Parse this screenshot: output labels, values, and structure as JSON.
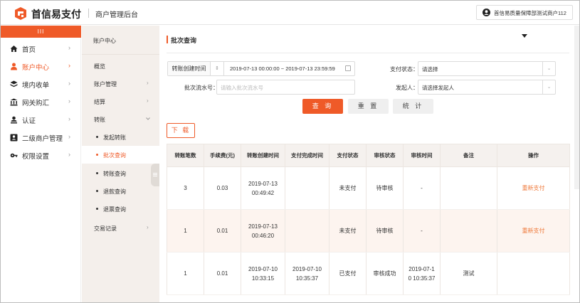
{
  "header": {
    "brand": "首信易支付",
    "subtitle": "商户管理后台",
    "user": "首信易质量保障部测试商户112"
  },
  "sidebar": {
    "collapse_label": "III",
    "items": [
      {
        "label": "首页",
        "icon": "home-icon"
      },
      {
        "label": "账户中心",
        "icon": "user-icon"
      },
      {
        "label": "境内收单",
        "icon": "layers-icon"
      },
      {
        "label": "网关购汇",
        "icon": "bank-icon"
      },
      {
        "label": "认证",
        "icon": "id-icon"
      },
      {
        "label": "二级商户管理",
        "icon": "account-box-icon"
      },
      {
        "label": "权限设置",
        "icon": "key-icon"
      }
    ],
    "arrow": "›"
  },
  "submenu": {
    "title": "账户中心",
    "items": [
      {
        "label": "概览"
      },
      {
        "label": "账户管理"
      },
      {
        "label": "结算"
      },
      {
        "label": "转账"
      }
    ],
    "sub_items": [
      {
        "label": "发起转账"
      },
      {
        "label": "批次查询"
      },
      {
        "label": "转账查询"
      },
      {
        "label": "退款查询"
      },
      {
        "label": "退票查询"
      }
    ],
    "tail_item": "交易记录"
  },
  "page": {
    "title": "批次查询",
    "filters": {
      "date_label": "转账创建时间",
      "date_range": "2019-07-13 00:00:00  ~  2019-07-13 23:59:59",
      "batch_label": "批次流水号：",
      "batch_placeholder": "请输入批次流水号",
      "pay_status_label": "支付状态：",
      "pay_status_value": "请选择",
      "initiator_label": "发起人：",
      "initiator_value": "请选择发起人"
    },
    "buttons": {
      "query": "查 询",
      "reset": "重 置",
      "stats": "统 计",
      "download": "下 载"
    }
  },
  "table": {
    "columns": [
      "转账笔数",
      "手续费(元)",
      "转账创建时间",
      "支付完成时间",
      "支付状态",
      "审核状态",
      "审核时间",
      "备注",
      "操作"
    ],
    "rows": [
      {
        "count": "3",
        "fee": "0.03",
        "created_1": "2019-07-13",
        "created_2": "00:49:42",
        "paid_1": "",
        "paid_2": "",
        "pay_status": "未支付",
        "audit_status": "待审核",
        "audit_1": "-",
        "audit_2": "",
        "remark": "",
        "op": "重新支付"
      },
      {
        "count": "1",
        "fee": "0.01",
        "created_1": "2019-07-13",
        "created_2": "00:46:20",
        "paid_1": "",
        "paid_2": "",
        "pay_status": "未支付",
        "audit_status": "待审核",
        "audit_1": "-",
        "audit_2": "",
        "remark": "",
        "op": "重新支付"
      },
      {
        "count": "1",
        "fee": "0.01",
        "created_1": "2019-07-10",
        "created_2": "10:33:15",
        "paid_1": "2019-07-10",
        "paid_2": "10:35:37",
        "pay_status": "已支付",
        "audit_status": "审核成功",
        "audit_1": "2019-07-1",
        "audit_2": "0 10:35:37",
        "remark": "测试",
        "op": ""
      }
    ]
  },
  "colors": {
    "accent": "#ef5a28"
  }
}
